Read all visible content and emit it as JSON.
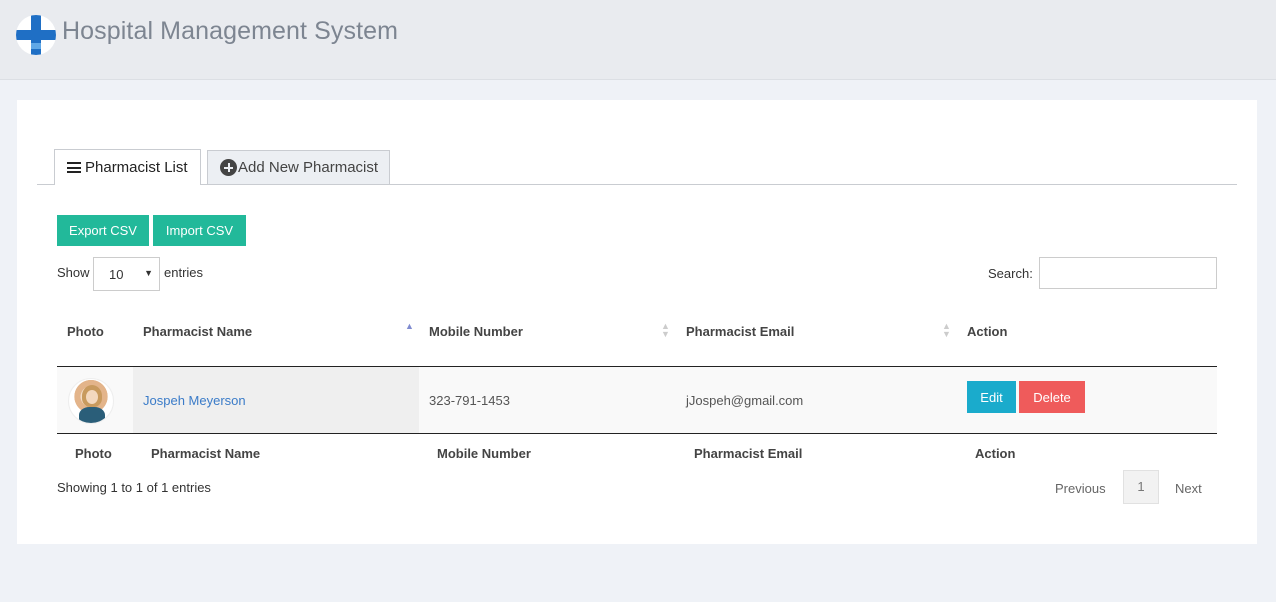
{
  "app": {
    "title": "Hospital Management System"
  },
  "tabs": [
    {
      "label": "Pharmacist List",
      "icon": "list-icon",
      "active": true
    },
    {
      "label": "Add New Pharmacist",
      "icon": "plus-circle-icon",
      "active": false
    }
  ],
  "toolbar": {
    "export_label": "Export CSV",
    "import_label": "Import CSV",
    "button_color": "#22b99a"
  },
  "length_menu": {
    "show_label": "Show",
    "value": "10",
    "entries_label": "entries"
  },
  "search": {
    "label": "Search:",
    "value": ""
  },
  "table": {
    "columns": [
      "Photo",
      "Pharmacist Name",
      "Mobile Number",
      "Pharmacist Email",
      "Action"
    ],
    "sorted_column": "Pharmacist Name",
    "rows": [
      {
        "photo": "avatar-photo",
        "name": "Jospeh Meyerson",
        "mobile": "323-791-1453",
        "email": "jJospeh@gmail.com",
        "edit_label": "Edit",
        "delete_label": "Delete"
      }
    ],
    "footer_columns": [
      "Photo",
      "Pharmacist Name",
      "Mobile Number",
      "Pharmacist Email",
      "Action"
    ]
  },
  "footer": {
    "info": "Showing 1 to 1 of 1 entries",
    "previous_label": "Previous",
    "current_page": "1",
    "next_label": "Next"
  },
  "colors": {
    "edit": "#1aabcc",
    "delete": "#ef5b5b",
    "link": "#3a7bc8"
  }
}
